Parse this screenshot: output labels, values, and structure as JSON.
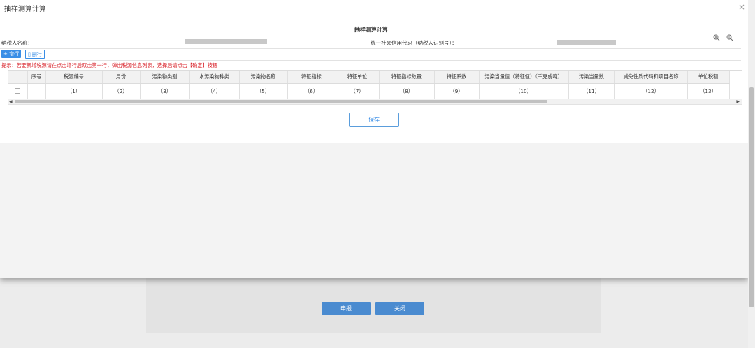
{
  "modal": {
    "title": "抽样测算计算",
    "close": "×"
  },
  "form": {
    "title": "抽样测算计算",
    "taxpayer_name_label": "纳税人名称：",
    "credit_code_label": "统一社会信用代码（纳税人识别号）："
  },
  "toolbar": {
    "add_label": "+ 增行",
    "delete_label": "删行"
  },
  "tip": "提示：若要新增税源请在点击增行后双击第一行，弹出税源信息列表，选择后请点击【确定】按钮",
  "grid": {
    "headers": [
      "",
      "序号",
      "税源编号",
      "月份",
      "污染物类别",
      "水污染物种类",
      "污染物名称",
      "特征指标",
      "特征单位",
      "特征指标数量",
      "特征系数",
      "污染当量值（特征值）（千克或吨）",
      "污染当量数",
      "减免性质代码和项目名称",
      "单位税额"
    ],
    "index_row": [
      "",
      "",
      "（1）",
      "（2）",
      "（3）",
      "（4）",
      "（5）",
      "（6）",
      "（7）",
      "（8）",
      "（9）",
      "（10）",
      "（11）",
      "（12）",
      "（13）"
    ]
  },
  "save_label": "保存",
  "background": {
    "submit_label": "申报",
    "close_label": "关闭"
  },
  "colors": {
    "accent": "#3a8ee6",
    "tip_red": "#d9242c"
  }
}
